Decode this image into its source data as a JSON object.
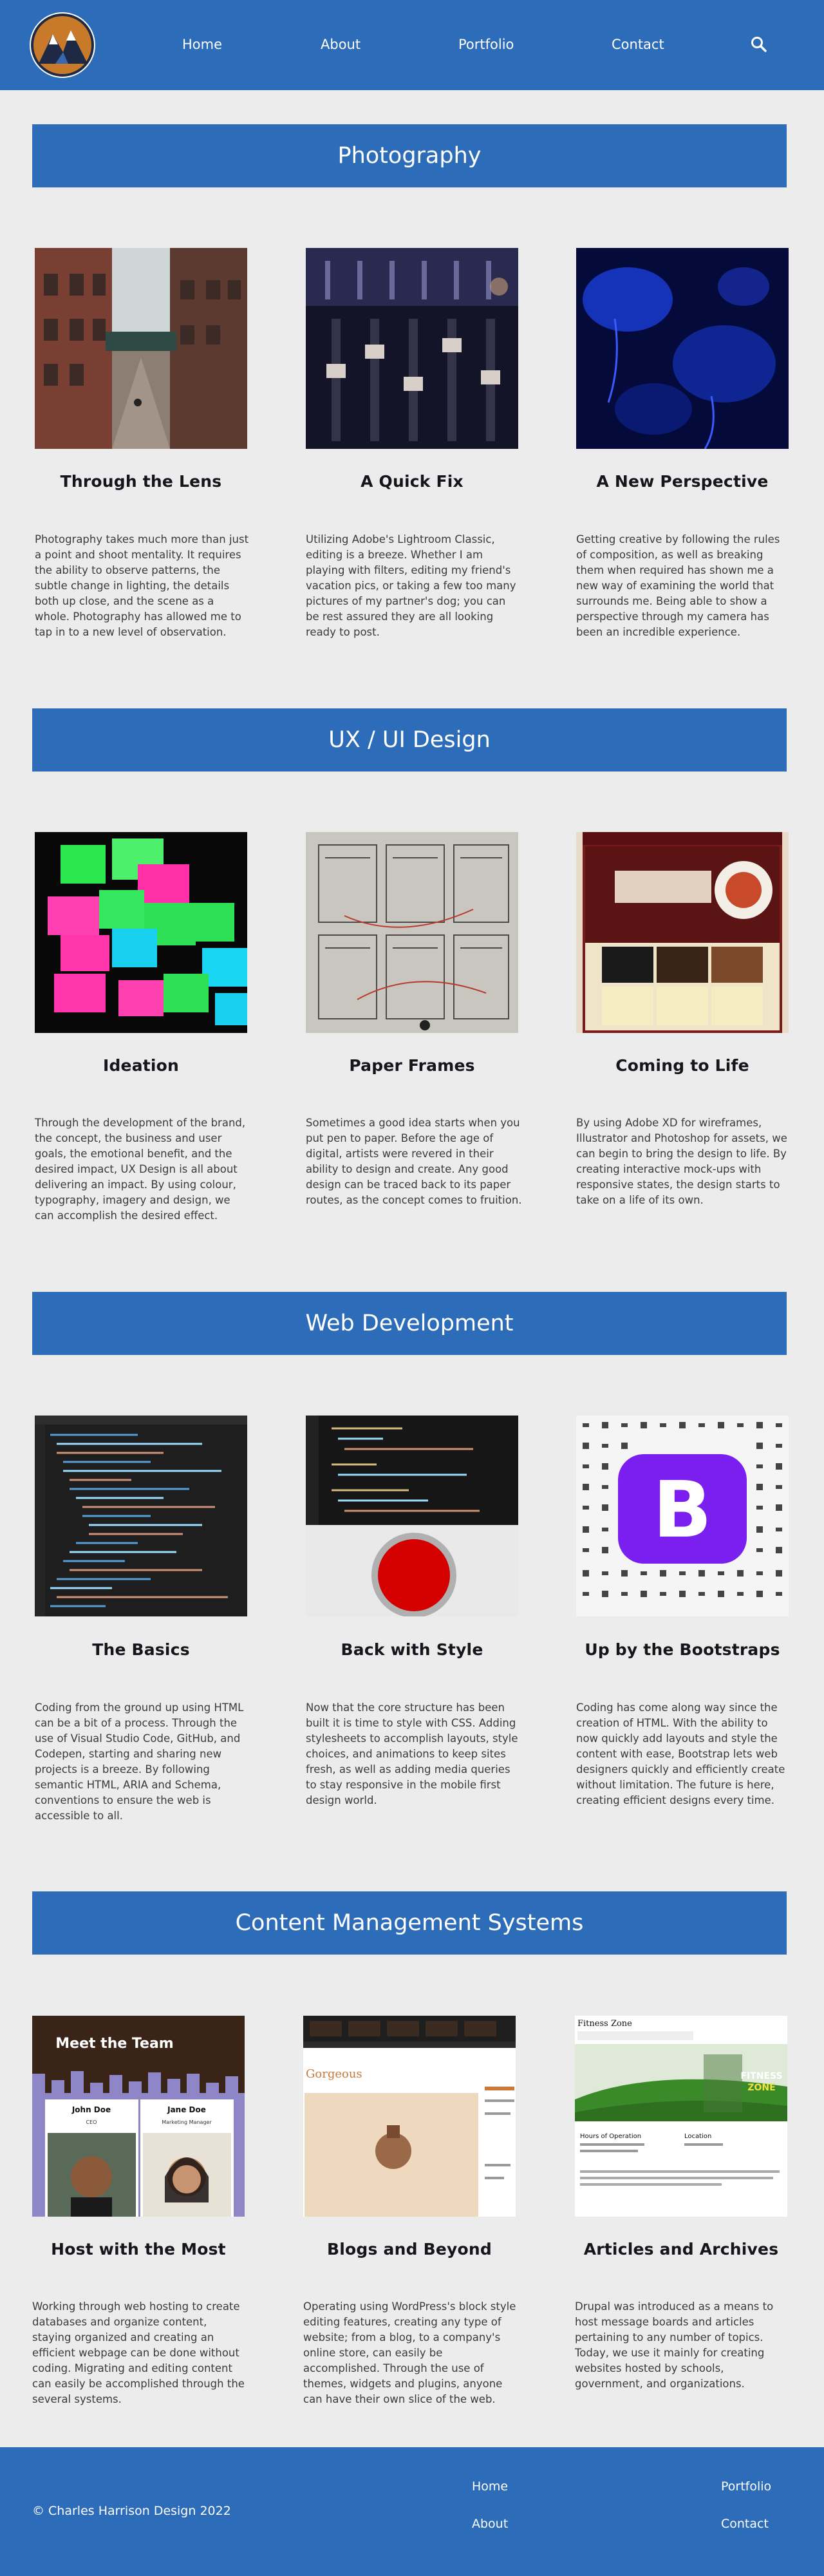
{
  "header": {
    "nav": [
      "Home",
      "About",
      "Portfolio",
      "Contact"
    ],
    "search_icon": "search-icon",
    "logo_icon": "mountain-logo"
  },
  "sections": [
    {
      "title": "Photography",
      "cards": [
        {
          "title": "Through the Lens",
          "text": "Photography takes much more than just a point and shoot mentality. It requires the ability to observe patterns, the subtle change in lighting, the details both up close, and the scene as a whole. Photography has allowed me to tap in to a new level of observation."
        },
        {
          "title": "A Quick Fix",
          "text": "Utilizing Adobe's Lightroom Classic, editing is a breeze. Whether I am playing with filters, editing my friend's vacation pics, or taking a few too many pictures of my partner's dog; you can be rest assured they are all looking ready to post."
        },
        {
          "title": "A New Perspective",
          "text": "Getting creative by following the rules of composition, as well as breaking them when required has shown me a new way of examining the world that surrounds me. Being able to show a perspective through my camera has been an incredible experience."
        }
      ]
    },
    {
      "title": "UX / UI Design",
      "cards": [
        {
          "title": "Ideation",
          "text": "Through the development of the brand, the concept, the business and user goals, the emotional benefit, and the desired impact, UX Design is all about delivering an impact. By using colour, typography, imagery and design, we can accomplish the desired effect."
        },
        {
          "title": "Paper Frames",
          "text": "Sometimes a good idea starts when you put pen to paper. Before the age of digital, artists were revered in their ability to design and create. Any good design can be traced back to its paper routes, as the concept comes to fruition."
        },
        {
          "title": "Coming to Life",
          "text": "By using Adobe XD for wireframes, Illustrator and Photoshop for assets, we can begin to bring the design to life. By creating interactive mock-ups with responsive states, the design starts to take on a life of its own."
        }
      ]
    },
    {
      "title": "Web Development",
      "cards": [
        {
          "title": "The Basics",
          "text": "Coding from the ground up using HTML can be a bit of a process. Through the use of Visual Studio Code, GitHub, and Codepen, starting and sharing new projects is a breeze. By following semantic HTML, ARIA and Schema, conventions to ensure the web is accessible to all."
        },
        {
          "title": "Back with Style",
          "text": "Now that the core structure has been built it is time to style with CSS. Adding stylesheets to accomplish layouts, style choices, and animations to keep sites fresh, as well as adding media queries to stay responsive in the mobile first design world."
        },
        {
          "title": "Up by the Bootstraps",
          "text": "Coding has come along way since the creation of HTML. With the ability to now quickly add layouts and style the content with ease, Bootstrap lets web designers quickly and efficiently create without limitation. The future is here, creating efficient designs every time."
        }
      ]
    },
    {
      "title": "Content Management Systems",
      "cards": [
        {
          "title": "Host with the Most",
          "text": "Working through web hosting to create databases and organize content, staying organized and creating an efficient webpage can be done without coding.  Migrating and editing content can easily be accomplished through the several systems."
        },
        {
          "title": "Blogs and Beyond",
          "text": "Operating using WordPress's block style editing features, creating any type of website; from a blog, to a company's online store, can easily be accomplished. Through the use of themes, widgets and plugins, anyone can have their own slice of the web."
        },
        {
          "title": "Articles and Archives",
          "text": "Drupal was introduced as a means to host message boards and articles pertaining to any number of topics. Today, we use it mainly for creating websites hosted by schools, government, and organizations."
        }
      ]
    }
  ],
  "image_text": {
    "team_title": "Meet the Team",
    "john_name": "John Doe",
    "john_role": "CEO",
    "jane_name": "Jane Doe",
    "jane_role": "Marketing Manager",
    "fitness_title": "Fitness Zone",
    "fitness_badge_1": "FITNESS",
    "fitness_badge_2": "ZONE",
    "hours_label": "Hours of Operation",
    "location_label": "Location",
    "wp_heading": "Gorgeous",
    "bootstrap_letter": "B"
  },
  "footer": {
    "copyright": "© Charles Harrison Design 2022",
    "links": [
      "Home",
      "Portfolio",
      "About",
      "Contact"
    ]
  },
  "colors": {
    "brand": "#2d6cb8",
    "background": "#ececec"
  }
}
